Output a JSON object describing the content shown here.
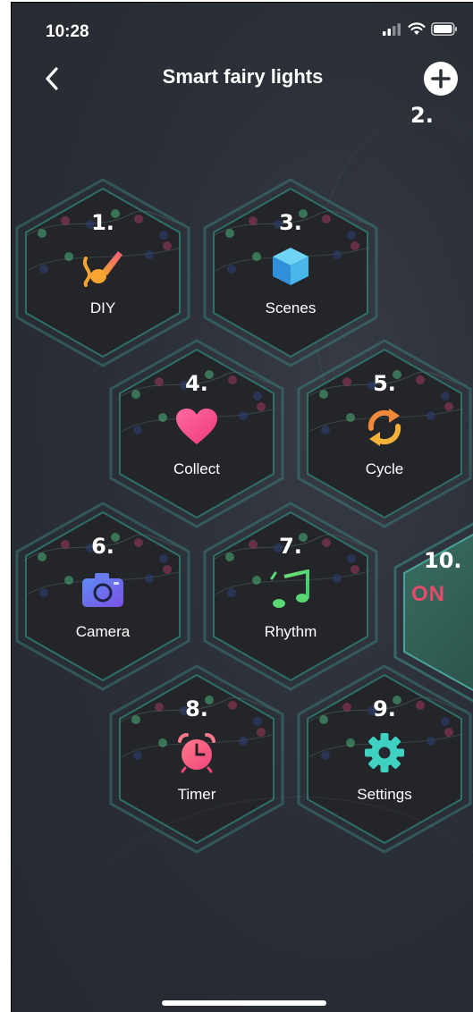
{
  "status_bar": {
    "time": "10:28"
  },
  "header": {
    "title": "Smart fairy lights"
  },
  "annotations": {
    "add": "2.",
    "on_tile": "10."
  },
  "tiles": [
    {
      "number": "1.",
      "label": "DIY",
      "icon": "paint-brush-icon"
    },
    {
      "number": "3.",
      "label": "Scenes",
      "icon": "cube-icon"
    },
    {
      "number": "4.",
      "label": "Collect",
      "icon": "heart-icon"
    },
    {
      "number": "5.",
      "label": "Cycle",
      "icon": "cycle-arrows-icon"
    },
    {
      "number": "6.",
      "label": "Camera",
      "icon": "camera-icon"
    },
    {
      "number": "7.",
      "label": "Rhythm",
      "icon": "music-note-icon"
    },
    {
      "number": "8.",
      "label": "Timer",
      "icon": "alarm-clock-icon"
    },
    {
      "number": "9.",
      "label": "Settings",
      "icon": "gear-icon"
    }
  ],
  "power_tile": {
    "label": "ON"
  },
  "colors": {
    "background": "#2b2f37",
    "hex_fill": "#26282e",
    "hex_border": "#3b8c86",
    "on_color": "#e84a6c",
    "on_tile_fill": "#2f5a4f"
  }
}
